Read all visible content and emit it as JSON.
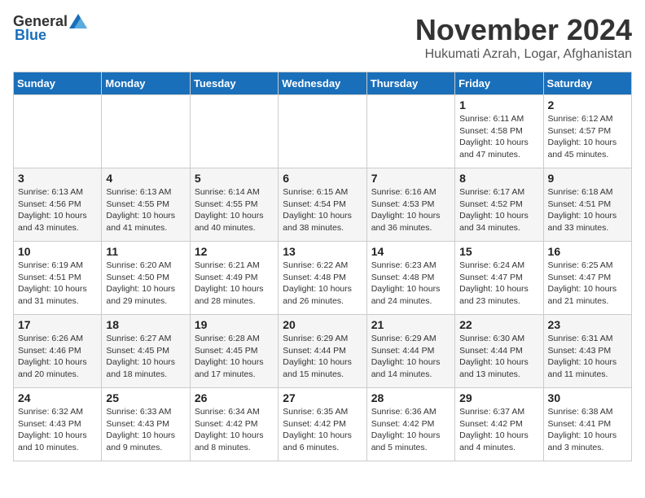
{
  "header": {
    "logo_general": "General",
    "logo_blue": "Blue",
    "month": "November 2024",
    "location": "Hukumati Azrah, Logar, Afghanistan"
  },
  "days_of_week": [
    "Sunday",
    "Monday",
    "Tuesday",
    "Wednesday",
    "Thursday",
    "Friday",
    "Saturday"
  ],
  "weeks": [
    [
      {
        "day": "",
        "info": ""
      },
      {
        "day": "",
        "info": ""
      },
      {
        "day": "",
        "info": ""
      },
      {
        "day": "",
        "info": ""
      },
      {
        "day": "",
        "info": ""
      },
      {
        "day": "1",
        "info": "Sunrise: 6:11 AM\nSunset: 4:58 PM\nDaylight: 10 hours\nand 47 minutes."
      },
      {
        "day": "2",
        "info": "Sunrise: 6:12 AM\nSunset: 4:57 PM\nDaylight: 10 hours\nand 45 minutes."
      }
    ],
    [
      {
        "day": "3",
        "info": "Sunrise: 6:13 AM\nSunset: 4:56 PM\nDaylight: 10 hours\nand 43 minutes."
      },
      {
        "day": "4",
        "info": "Sunrise: 6:13 AM\nSunset: 4:55 PM\nDaylight: 10 hours\nand 41 minutes."
      },
      {
        "day": "5",
        "info": "Sunrise: 6:14 AM\nSunset: 4:55 PM\nDaylight: 10 hours\nand 40 minutes."
      },
      {
        "day": "6",
        "info": "Sunrise: 6:15 AM\nSunset: 4:54 PM\nDaylight: 10 hours\nand 38 minutes."
      },
      {
        "day": "7",
        "info": "Sunrise: 6:16 AM\nSunset: 4:53 PM\nDaylight: 10 hours\nand 36 minutes."
      },
      {
        "day": "8",
        "info": "Sunrise: 6:17 AM\nSunset: 4:52 PM\nDaylight: 10 hours\nand 34 minutes."
      },
      {
        "day": "9",
        "info": "Sunrise: 6:18 AM\nSunset: 4:51 PM\nDaylight: 10 hours\nand 33 minutes."
      }
    ],
    [
      {
        "day": "10",
        "info": "Sunrise: 6:19 AM\nSunset: 4:51 PM\nDaylight: 10 hours\nand 31 minutes."
      },
      {
        "day": "11",
        "info": "Sunrise: 6:20 AM\nSunset: 4:50 PM\nDaylight: 10 hours\nand 29 minutes."
      },
      {
        "day": "12",
        "info": "Sunrise: 6:21 AM\nSunset: 4:49 PM\nDaylight: 10 hours\nand 28 minutes."
      },
      {
        "day": "13",
        "info": "Sunrise: 6:22 AM\nSunset: 4:48 PM\nDaylight: 10 hours\nand 26 minutes."
      },
      {
        "day": "14",
        "info": "Sunrise: 6:23 AM\nSunset: 4:48 PM\nDaylight: 10 hours\nand 24 minutes."
      },
      {
        "day": "15",
        "info": "Sunrise: 6:24 AM\nSunset: 4:47 PM\nDaylight: 10 hours\nand 23 minutes."
      },
      {
        "day": "16",
        "info": "Sunrise: 6:25 AM\nSunset: 4:47 PM\nDaylight: 10 hours\nand 21 minutes."
      }
    ],
    [
      {
        "day": "17",
        "info": "Sunrise: 6:26 AM\nSunset: 4:46 PM\nDaylight: 10 hours\nand 20 minutes."
      },
      {
        "day": "18",
        "info": "Sunrise: 6:27 AM\nSunset: 4:45 PM\nDaylight: 10 hours\nand 18 minutes."
      },
      {
        "day": "19",
        "info": "Sunrise: 6:28 AM\nSunset: 4:45 PM\nDaylight: 10 hours\nand 17 minutes."
      },
      {
        "day": "20",
        "info": "Sunrise: 6:29 AM\nSunset: 4:44 PM\nDaylight: 10 hours\nand 15 minutes."
      },
      {
        "day": "21",
        "info": "Sunrise: 6:29 AM\nSunset: 4:44 PM\nDaylight: 10 hours\nand 14 minutes."
      },
      {
        "day": "22",
        "info": "Sunrise: 6:30 AM\nSunset: 4:44 PM\nDaylight: 10 hours\nand 13 minutes."
      },
      {
        "day": "23",
        "info": "Sunrise: 6:31 AM\nSunset: 4:43 PM\nDaylight: 10 hours\nand 11 minutes."
      }
    ],
    [
      {
        "day": "24",
        "info": "Sunrise: 6:32 AM\nSunset: 4:43 PM\nDaylight: 10 hours\nand 10 minutes."
      },
      {
        "day": "25",
        "info": "Sunrise: 6:33 AM\nSunset: 4:43 PM\nDaylight: 10 hours\nand 9 minutes."
      },
      {
        "day": "26",
        "info": "Sunrise: 6:34 AM\nSunset: 4:42 PM\nDaylight: 10 hours\nand 8 minutes."
      },
      {
        "day": "27",
        "info": "Sunrise: 6:35 AM\nSunset: 4:42 PM\nDaylight: 10 hours\nand 6 minutes."
      },
      {
        "day": "28",
        "info": "Sunrise: 6:36 AM\nSunset: 4:42 PM\nDaylight: 10 hours\nand 5 minutes."
      },
      {
        "day": "29",
        "info": "Sunrise: 6:37 AM\nSunset: 4:42 PM\nDaylight: 10 hours\nand 4 minutes."
      },
      {
        "day": "30",
        "info": "Sunrise: 6:38 AM\nSunset: 4:41 PM\nDaylight: 10 hours\nand 3 minutes."
      }
    ]
  ]
}
